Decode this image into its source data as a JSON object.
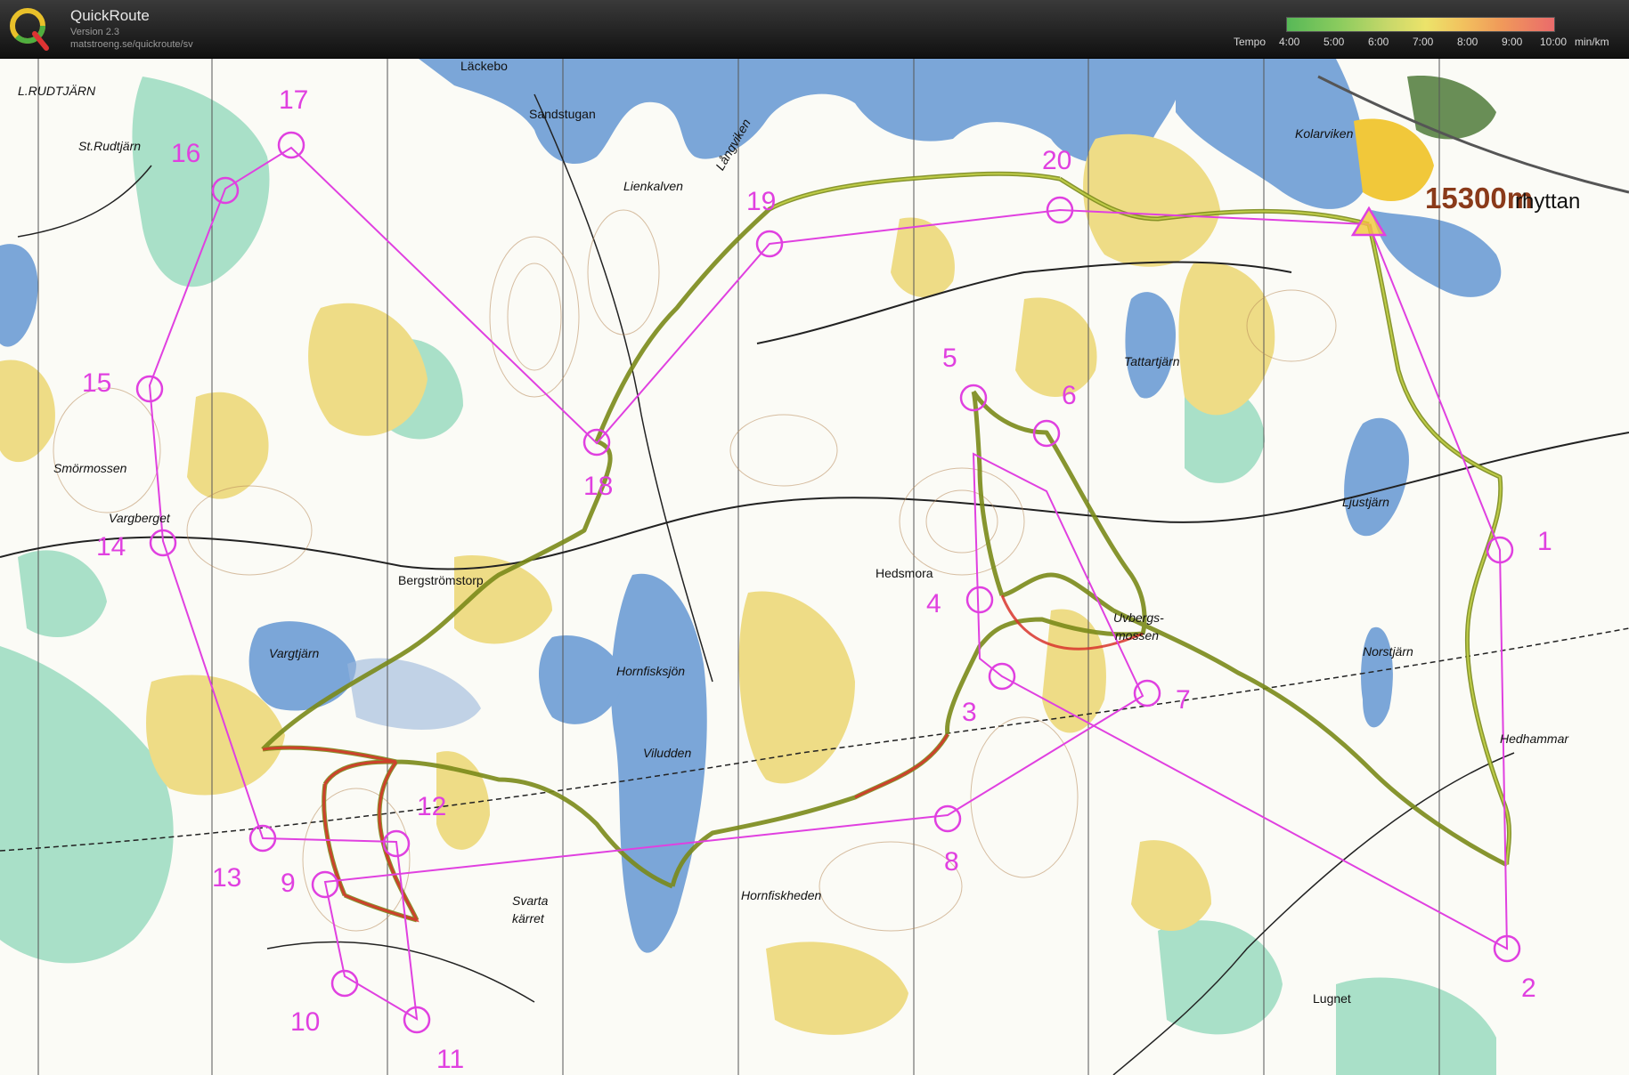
{
  "app": {
    "logo_letter": "Q",
    "title": "QuickRoute",
    "version": "Version 2.3",
    "url": "matstroeng.se/quickroute/sv"
  },
  "tempo_legend": {
    "label": "Tempo",
    "ticks": [
      "4:00",
      "5:00",
      "6:00",
      "7:00",
      "8:00",
      "9:00",
      "10:00"
    ],
    "unit": "min/km",
    "colors": [
      "#57b857",
      "#c8d86a",
      "#ece36a",
      "#f09a5a",
      "#ea6b6b"
    ]
  },
  "route": {
    "distance_label": "15300m",
    "route_color": "#7a8a1a",
    "course_color": "#e040e0"
  },
  "controls": [
    "1",
    "2",
    "3",
    "4",
    "5",
    "6",
    "7",
    "8",
    "9",
    "10",
    "11",
    "12",
    "13",
    "14",
    "15",
    "16",
    "17",
    "18",
    "19",
    "20"
  ],
  "place_names": {
    "l_rudtjarn": "L.RUDTJÄRN",
    "st_rudtjarn": "St.Rudtjärn",
    "lackebo": "Läckebo",
    "sandstugan": "Sandstugan",
    "lienkalven": "Lienkalven",
    "langviken": "Långviken",
    "kolarviken": "Kolarviken",
    "tartar": "rhyttan",
    "tattartjarn": "Tattartjärn",
    "ljustjarn": "Ljustjärn",
    "smormossen": "Smörmossen",
    "vargberget": "Vargberget",
    "bergstromstorp": "Bergströmstorp",
    "vargtjarn": "Vargtjärn",
    "hornfisksjon": "Hornfisksjön",
    "viludden": "Viludden",
    "hedsmora": "Hedsmora",
    "uvbergsmossen_1": "Uvbergs-",
    "uvbergsmossen_2": "mossen",
    "norstjarn": "Norstjärn",
    "hedhammar": "Hedhammar",
    "svarta_1": "Svarta",
    "svarta_2": "kärret",
    "hornfiskheden": "Hornfiskheden",
    "lugnet": "Lugnet"
  }
}
